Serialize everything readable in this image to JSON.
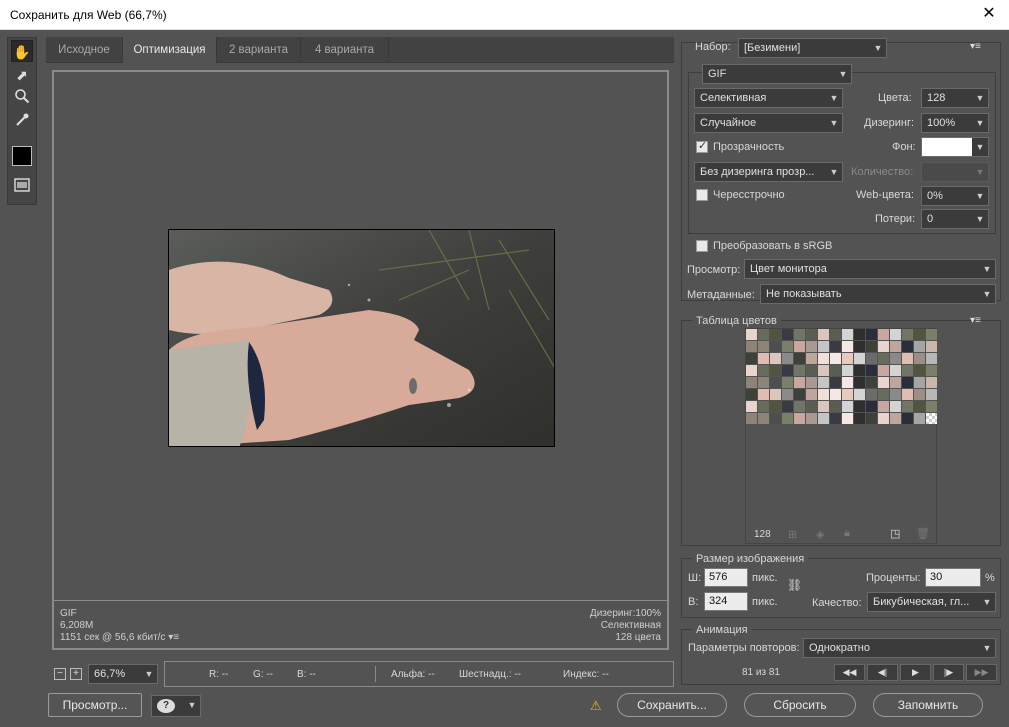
{
  "window": {
    "title": "Сохранить для Web (66,7%)",
    "close": "✕"
  },
  "tabs": [
    "Исходное",
    "Оптимизация",
    "2 варианта",
    "4 варианта"
  ],
  "info_left": {
    "format": "GIF",
    "size": "6,208M",
    "time": "1151 сек @ 56,6 кбит/с"
  },
  "info_right": {
    "dither": "Дизеринг:100%",
    "palette": "Селективная",
    "colors": "128 цвета"
  },
  "zoom": {
    "value": "66,7%"
  },
  "readout": {
    "r": "R: --",
    "g": "G: --",
    "b": "B: --",
    "alpha": "Альфа: --",
    "hex": "Шестнадц.: --",
    "index": "Индекс: --"
  },
  "bottom_buttons": {
    "preview": "Просмотр...",
    "save": "Сохранить...",
    "reset": "Сбросить",
    "remember": "Запомнить"
  },
  "settings": {
    "preset_label": "Набор:",
    "preset_value": "[Безимени]",
    "format": "GIF",
    "reduction": "Селективная",
    "colors_label": "Цвета:",
    "colors_value": "128",
    "dither_algo": "Случайное",
    "dither_label": "Дизеринг:",
    "dither_value": "100%",
    "transparency": "Прозрачность",
    "matte_label": "Фон:",
    "trans_dither": "Без дизеринга прозр...",
    "amount_label": "Количество:",
    "interlaced": "Чересстрочно",
    "web_label": "Web-цвета:",
    "web_value": "0%",
    "lossy_label": "Потери:",
    "lossy_value": "0",
    "convert_srgb": "Преобразовать в sRGB",
    "preview_label": "Просмотр:",
    "preview_value": "Цвет монитора",
    "metadata_label": "Метаданные:",
    "metadata_value": "Не показывать"
  },
  "color_table": {
    "title": "Таблица цветов",
    "count": "128"
  },
  "image_size": {
    "title": "Размер изображения",
    "w_label": "Ш:",
    "w_value": "576",
    "h_label": "В:",
    "h_value": "324",
    "unit": "пикс.",
    "percent_label": "Проценты:",
    "percent_value": "30",
    "percent_sign": "%",
    "quality_label": "Качество:",
    "quality_value": "Бикубическая, гл..."
  },
  "animation": {
    "title": "Анимация",
    "loop_label": "Параметры повторов:",
    "loop_value": "Однократно",
    "frame": "81 из 81"
  }
}
